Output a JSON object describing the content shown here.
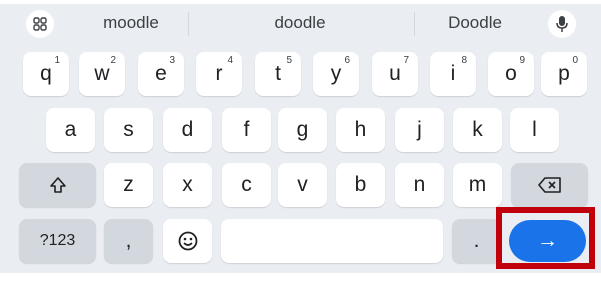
{
  "suggestions": [
    "moodle",
    "doodle",
    "Doodle"
  ],
  "icons": {
    "apps": "apps-grid-icon",
    "mic": "microphone-icon",
    "shift": "shift-icon",
    "backspace": "backspace-icon",
    "emoji": "emoji-icon",
    "enter": "arrow-right-icon"
  },
  "rows": {
    "row1": [
      {
        "label": "q",
        "sup": "1"
      },
      {
        "label": "w",
        "sup": "2"
      },
      {
        "label": "e",
        "sup": "3"
      },
      {
        "label": "r",
        "sup": "4"
      },
      {
        "label": "t",
        "sup": "5"
      },
      {
        "label": "y",
        "sup": "6"
      },
      {
        "label": "u",
        "sup": "7"
      },
      {
        "label": "i",
        "sup": "8"
      },
      {
        "label": "o",
        "sup": "9"
      },
      {
        "label": "p",
        "sup": "0"
      }
    ],
    "row2": [
      "a",
      "s",
      "d",
      "f",
      "g",
      "h",
      "j",
      "k",
      "l"
    ],
    "row3": [
      "z",
      "x",
      "c",
      "v",
      "b",
      "n",
      "m"
    ],
    "row4": {
      "symbols_label": "?123",
      "comma": ",",
      "period": ".",
      "enter_glyph": "→"
    }
  },
  "colors": {
    "keyboard_bg": "#eaedf2",
    "key_bg": "#ffffff",
    "fn_key_bg": "#d3d7de",
    "enter_bg": "#1a73e8",
    "highlight": "#c0000b"
  }
}
